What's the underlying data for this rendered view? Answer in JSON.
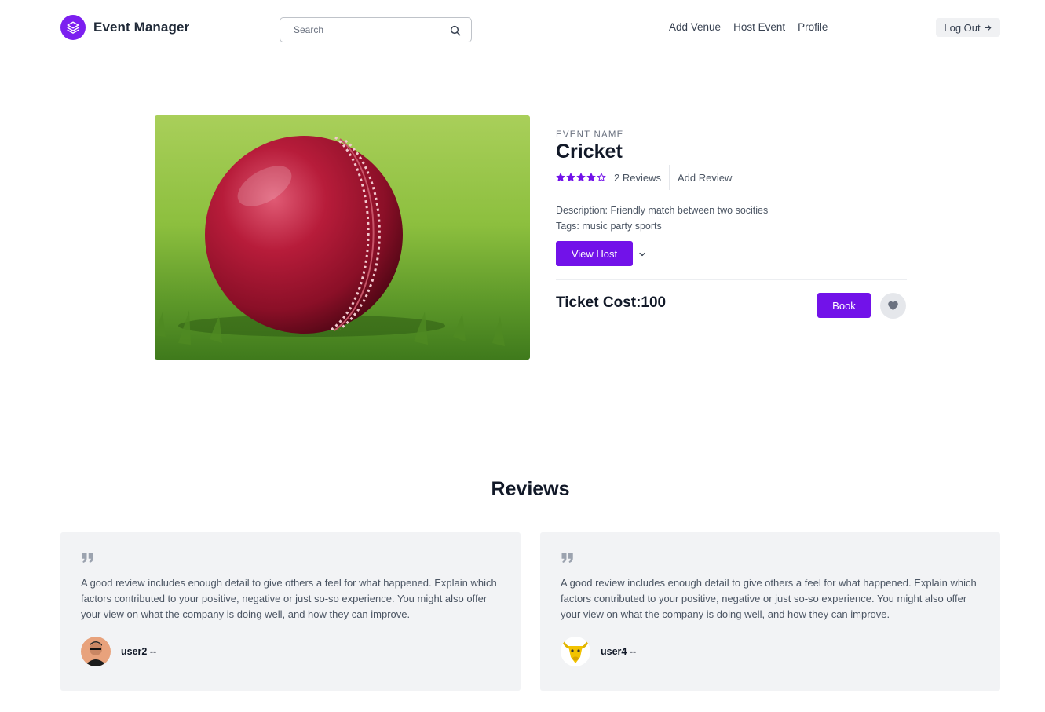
{
  "brand": {
    "name": "Event Manager",
    "logo_icon": "layers-icon",
    "color": "#7c1ff0"
  },
  "search": {
    "placeholder": "Search",
    "value": ""
  },
  "nav": {
    "items": [
      {
        "label": "Add Venue"
      },
      {
        "label": "Host Event"
      },
      {
        "label": "Profile"
      }
    ]
  },
  "logout": {
    "label": "Log Out"
  },
  "event": {
    "eyebrow": "EVENT NAME",
    "name": "Cricket",
    "rating": 4,
    "rating_max": 5,
    "reviews_label": "2 Reviews",
    "add_review_label": "Add Review",
    "description": "Description: Friendly match between two socities",
    "tags": "Tags: music party sports",
    "view_host_label": "View Host",
    "ticket_cost": "Ticket Cost:100",
    "book_label": "Book",
    "accent": "#7212e9"
  },
  "reviews": {
    "title": "Reviews",
    "items": [
      {
        "text": "A good review includes enough detail to give others a feel for what happened. Explain which factors contributed to your positive, negative or just so-so experience. You might also offer your view on what the company is doing well, and how they can improve.",
        "author": "user2 --"
      },
      {
        "text": "A good review includes enough detail to give others a feel for what happened. Explain which factors contributed to your positive, negative or just so-so experience. You might also offer your view on what the company is doing well, and how they can improve.",
        "author": "user4 --"
      }
    ]
  }
}
